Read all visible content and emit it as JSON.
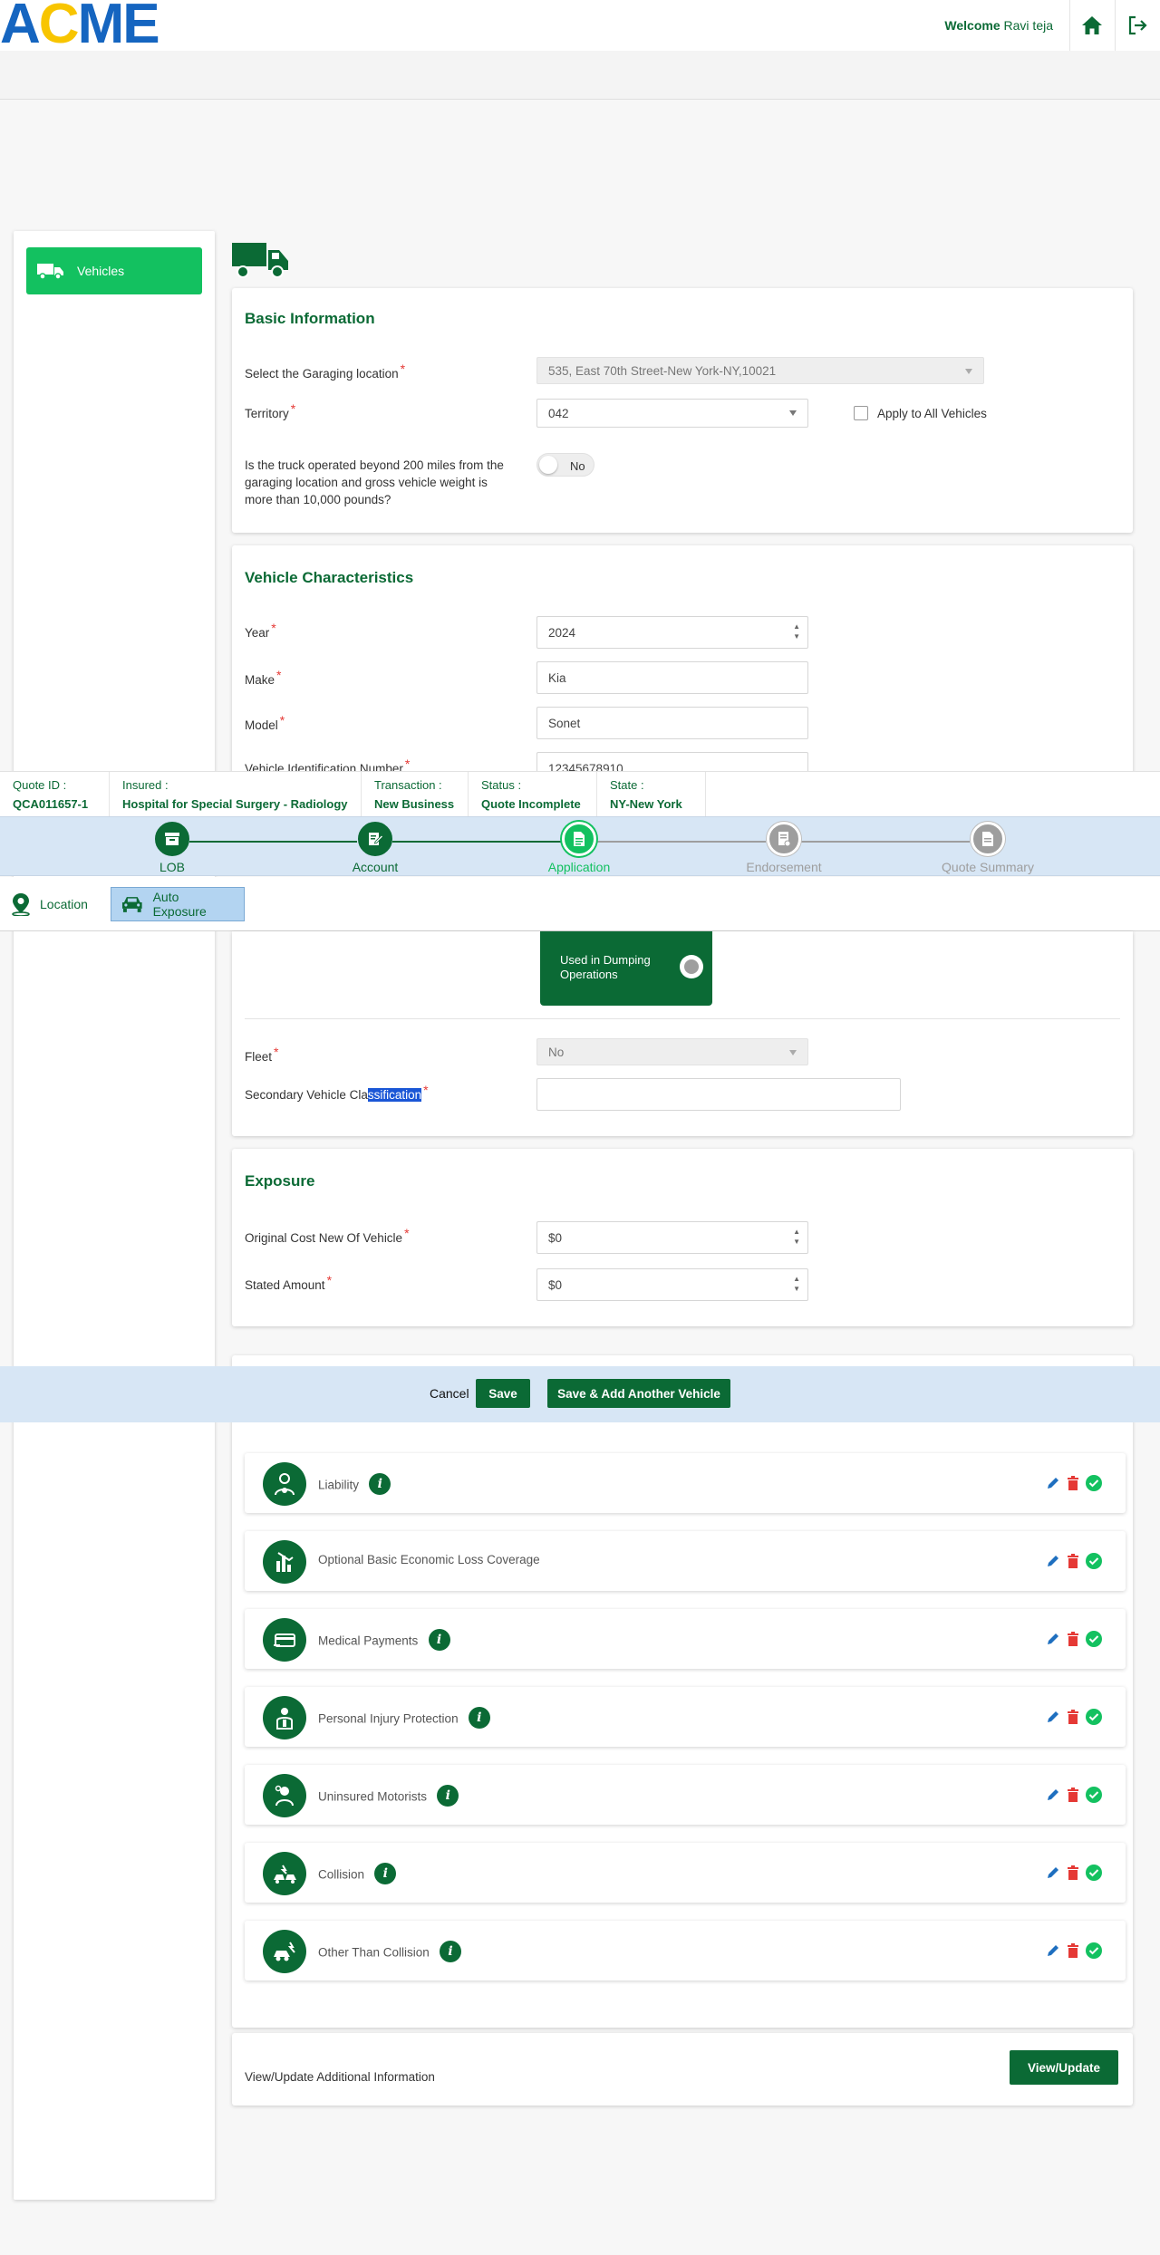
{
  "header": {
    "logo_a": "A",
    "logo_c": "C",
    "logo_me": "ME",
    "welcome_prefix": "Welcome",
    "user": "Ravi teja"
  },
  "sidebar": {
    "vehicles_label": "Vehicles"
  },
  "basic_info": {
    "title": "Basic Information",
    "garaging_label": "Select the Garaging location",
    "garaging_value": "535, East 70th Street-New York-NY,10021",
    "territory_label": "Territory",
    "territory_value": "042",
    "apply_all_label": "Apply to All Vehicles",
    "truck_q_line1": "Is the truck operated beyond 200 miles from the",
    "truck_q_line2": "garaging location and gross vehicle weight is",
    "truck_q_line3": "more than 10,000 pounds?",
    "truck_toggle": "No"
  },
  "vehicle_chars": {
    "title": "Vehicle Characteristics",
    "year_label": "Year",
    "year_value": "2024",
    "make_label": "Make",
    "make_value": "Kia",
    "model_label": "Model",
    "model_value": "Sonet",
    "vin_label": "Vehicle Identification Number",
    "vin_value": "12345678910",
    "dumping_line1": "Used in Dumping",
    "dumping_line2": "Operations",
    "fleet_label": "Fleet",
    "fleet_value": "No",
    "secondary_label_a": "Secondary Vehicle Cla",
    "secondary_label_b": "ssification",
    "secondary_value": ""
  },
  "quote_bar": {
    "quote_id_label": "Quote ID :",
    "quote_id": "QCA011657-1",
    "insured_label": "Insured :",
    "insured": "Hospital for Special Surgery - Radiology",
    "transaction_label": "Transaction :",
    "transaction": "New Business",
    "status_label": "Status :",
    "status": "Quote Incomplete",
    "state_label": "State :",
    "state": "NY-New York"
  },
  "steps": [
    {
      "label": "LOB",
      "state": "done"
    },
    {
      "label": "Account",
      "state": "done"
    },
    {
      "label": "Application",
      "state": "active"
    },
    {
      "label": "Endorsement",
      "state": "pending"
    },
    {
      "label": "Quote Summary",
      "state": "pending"
    }
  ],
  "tabs": {
    "location": "Location",
    "auto_exposure": "Auto Exposure"
  },
  "exposure": {
    "title": "Exposure",
    "ocn_label": "Original Cost New Of Vehicle",
    "ocn_value": "$0",
    "stated_label": "Stated Amount",
    "stated_value": "$0"
  },
  "actions": {
    "cancel": "Cancel",
    "save": "Save",
    "save_add": "Save & Add Another Vehicle"
  },
  "coverages": [
    {
      "name": "Liability",
      "info": true,
      "icon": "liability-icon"
    },
    {
      "name": "Optional Basic Economic Loss Coverage",
      "info": false,
      "icon": "economic-loss-icon"
    },
    {
      "name": "Medical Payments",
      "info": true,
      "icon": "medical-payments-icon"
    },
    {
      "name": "Personal Injury Protection",
      "info": true,
      "icon": "personal-injury-icon"
    },
    {
      "name": "Uninsured Motorists",
      "info": true,
      "icon": "uninsured-motorists-icon"
    },
    {
      "name": "Collision",
      "info": true,
      "icon": "collision-icon"
    },
    {
      "name": "Other Than Collision",
      "info": true,
      "icon": "other-than-collision-icon"
    }
  ],
  "additional": {
    "label": "View/Update Additional Information",
    "button": "View/Update"
  },
  "colors": {
    "brand_green": "#0b6a35",
    "accent_green": "#13c160",
    "bar_blue": "#d7e6f5",
    "logo_blue": "#1565c0",
    "logo_yellow": "#f8c500"
  }
}
